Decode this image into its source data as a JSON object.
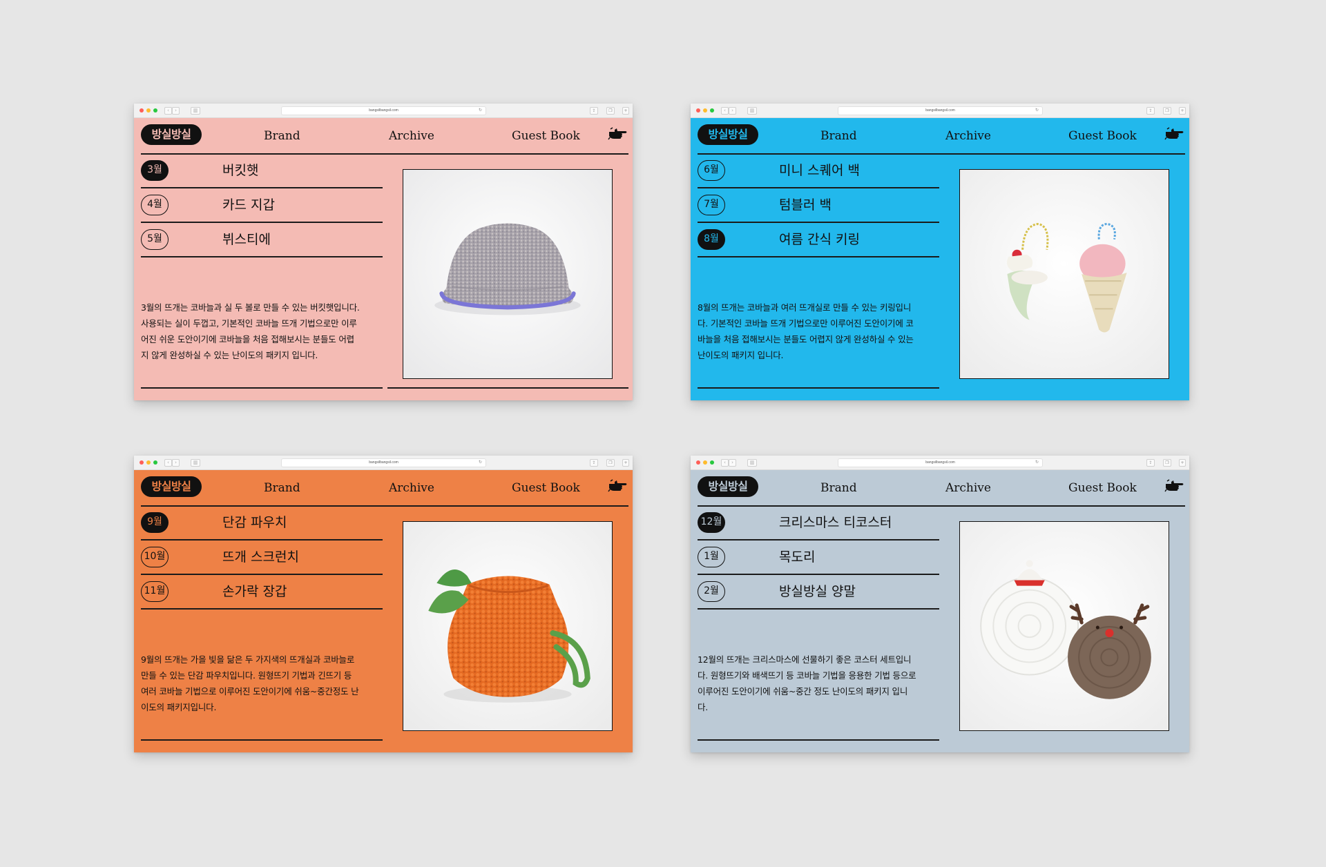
{
  "url": "bangsilbangsil.com",
  "nav": {
    "brand": "Brand",
    "archive": "Archive",
    "guest_book": "Guest Book"
  },
  "logo": "방실방실",
  "windows": [
    {
      "bg": "#f4bbb4",
      "logo_text_color": "#f4bbb4",
      "items": [
        {
          "month": "3월",
          "name": "버킷햇"
        },
        {
          "month": "4월",
          "name": "카드 지갑"
        },
        {
          "month": "5월",
          "name": "뷔스티에"
        }
      ],
      "active_index": 0,
      "description": [
        "3월의 뜨개는 코바늘과 실 두 볼로 만들 수 있는 버킷햇입니다.",
        "사용되는 실이 두껍고, 기본적인 코바늘 뜨개 기법으로만 이루",
        "어진 쉬운 도안이기에 코바늘을 처음 접해보시는 분들도 어렵",
        "지 않게 완성하실 수 있는 난이도의 패키지 입니다."
      ],
      "image": "bucket-hat"
    },
    {
      "bg": "#22b8ec",
      "logo_text_color": "#22b8ec",
      "items": [
        {
          "month": "6월",
          "name": "미니 스퀘어 백"
        },
        {
          "month": "7월",
          "name": "텀블러 백"
        },
        {
          "month": "8월",
          "name": "여름 간식 키링"
        }
      ],
      "active_index": 2,
      "description": [
        "8월의 뜨개는 코바늘과 여러 뜨개실로 만들 수 있는 키링입니",
        "다. 기본적인 코바늘 뜨개 기법으로만 이루어진 도안이기에 코",
        "바늘을 처음 접해보시는 분들도 어렵지 않게 완성하실 수 있는",
        "난이도의 패키지 입니다."
      ],
      "image": "summer-snack-keyrings"
    },
    {
      "bg": "#ee8146",
      "logo_text_color": "#ee8146",
      "items": [
        {
          "month": "9월",
          "name": "단감 파우치"
        },
        {
          "month": "10월",
          "name": "뜨개 스크런치"
        },
        {
          "month": "11월",
          "name": "손가락 장갑"
        }
      ],
      "active_index": 0,
      "description": [
        "9월의 뜨개는 가을 빛을 닮은 두 가지색의 뜨개실과 코바늘로",
        "만들 수 있는 단감 파우치입니다. 원형뜨기 기법과 긴뜨기 등",
        "여러 코바늘 기법으로 이루어진 도안이기에 쉬움~중간정도 난",
        "이도의 패키지입니다."
      ],
      "image": "persimmon-pouch"
    },
    {
      "bg": "#bccad6",
      "logo_text_color": "#bccad6",
      "items": [
        {
          "month": "12월",
          "name": "크리스마스 티코스터"
        },
        {
          "month": "1월",
          "name": "목도리"
        },
        {
          "month": "2월",
          "name": "방실방실 양말"
        }
      ],
      "active_index": 0,
      "description": [
        "12월의 뜨개는 크리스마스에 선물하기 좋은 코스터 세트입니",
        "다. 원형뜨기와 배색뜨기 등 코바늘 기법을 응용한 기법 등으로",
        "이루어진 도안이기에 쉬움~중간 정도 난이도의 패키지 입니",
        "다."
      ],
      "image": "christmas-coasters"
    }
  ]
}
